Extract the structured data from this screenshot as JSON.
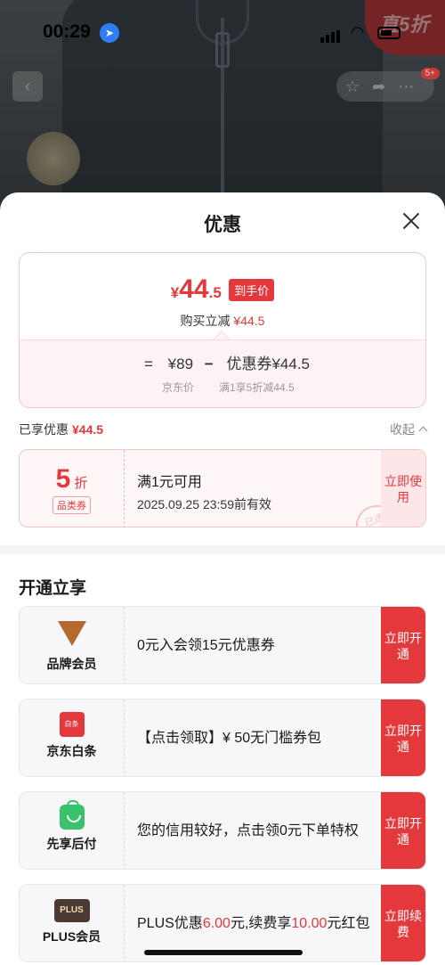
{
  "status_bar": {
    "time": "00:29"
  },
  "background": {
    "promo_badge": "直5折",
    "cart_count": "5+"
  },
  "sheet": {
    "title": "优惠",
    "price_summary": {
      "final_price_yen": "¥",
      "final_price_int": "44",
      "final_price_dec": ".5",
      "final_tag": "到手价",
      "reduce_label": "购买立减",
      "reduce_value": "¥44.5",
      "formula_eq": "=",
      "jd_price": "¥89",
      "formula_minus": "−",
      "coupon_label": "优惠券¥44.5",
      "jd_price_caption": "京东价",
      "coupon_caption": "满1享5折减44.5"
    },
    "enjoyed": {
      "label": "已享优惠",
      "value": "¥44.5",
      "collapse_label": "收起"
    },
    "coupon": {
      "discount": "5",
      "unit": "折",
      "type": "品类券",
      "condition": "满1元可用",
      "validity": "2025.09.25 23:59前有效",
      "use_label": "立即使用",
      "stamp": "已选"
    },
    "open_section_title": "开通立享",
    "benefits": [
      {
        "name": "品牌会员",
        "desc": "0元入会领15元优惠券",
        "button": "立即开通",
        "icon": "brand-v-icon"
      },
      {
        "name": "京东白条",
        "desc": "【点击领取】¥ 50无门槛券包",
        "button": "立即开通",
        "icon": "baitiao-icon",
        "icon_text": "白条"
      },
      {
        "name": "先享后付",
        "desc": "您的信用较好，点击领0元下单特权",
        "button": "立即开通",
        "icon": "shopping-bag-icon"
      },
      {
        "name": "PLUS会员",
        "desc_pre": "PLUS优惠",
        "desc_val1": "6.00",
        "desc_mid": "元,续费享",
        "desc_val2": "10.00",
        "desc_post": "元红包",
        "button": "立即续费",
        "icon": "plus-logo-icon",
        "icon_text": "PLUS"
      }
    ]
  },
  "colors": {
    "accent": "#e4393c",
    "brand_member": "#b36a2c",
    "pay_later": "#38c26b"
  }
}
